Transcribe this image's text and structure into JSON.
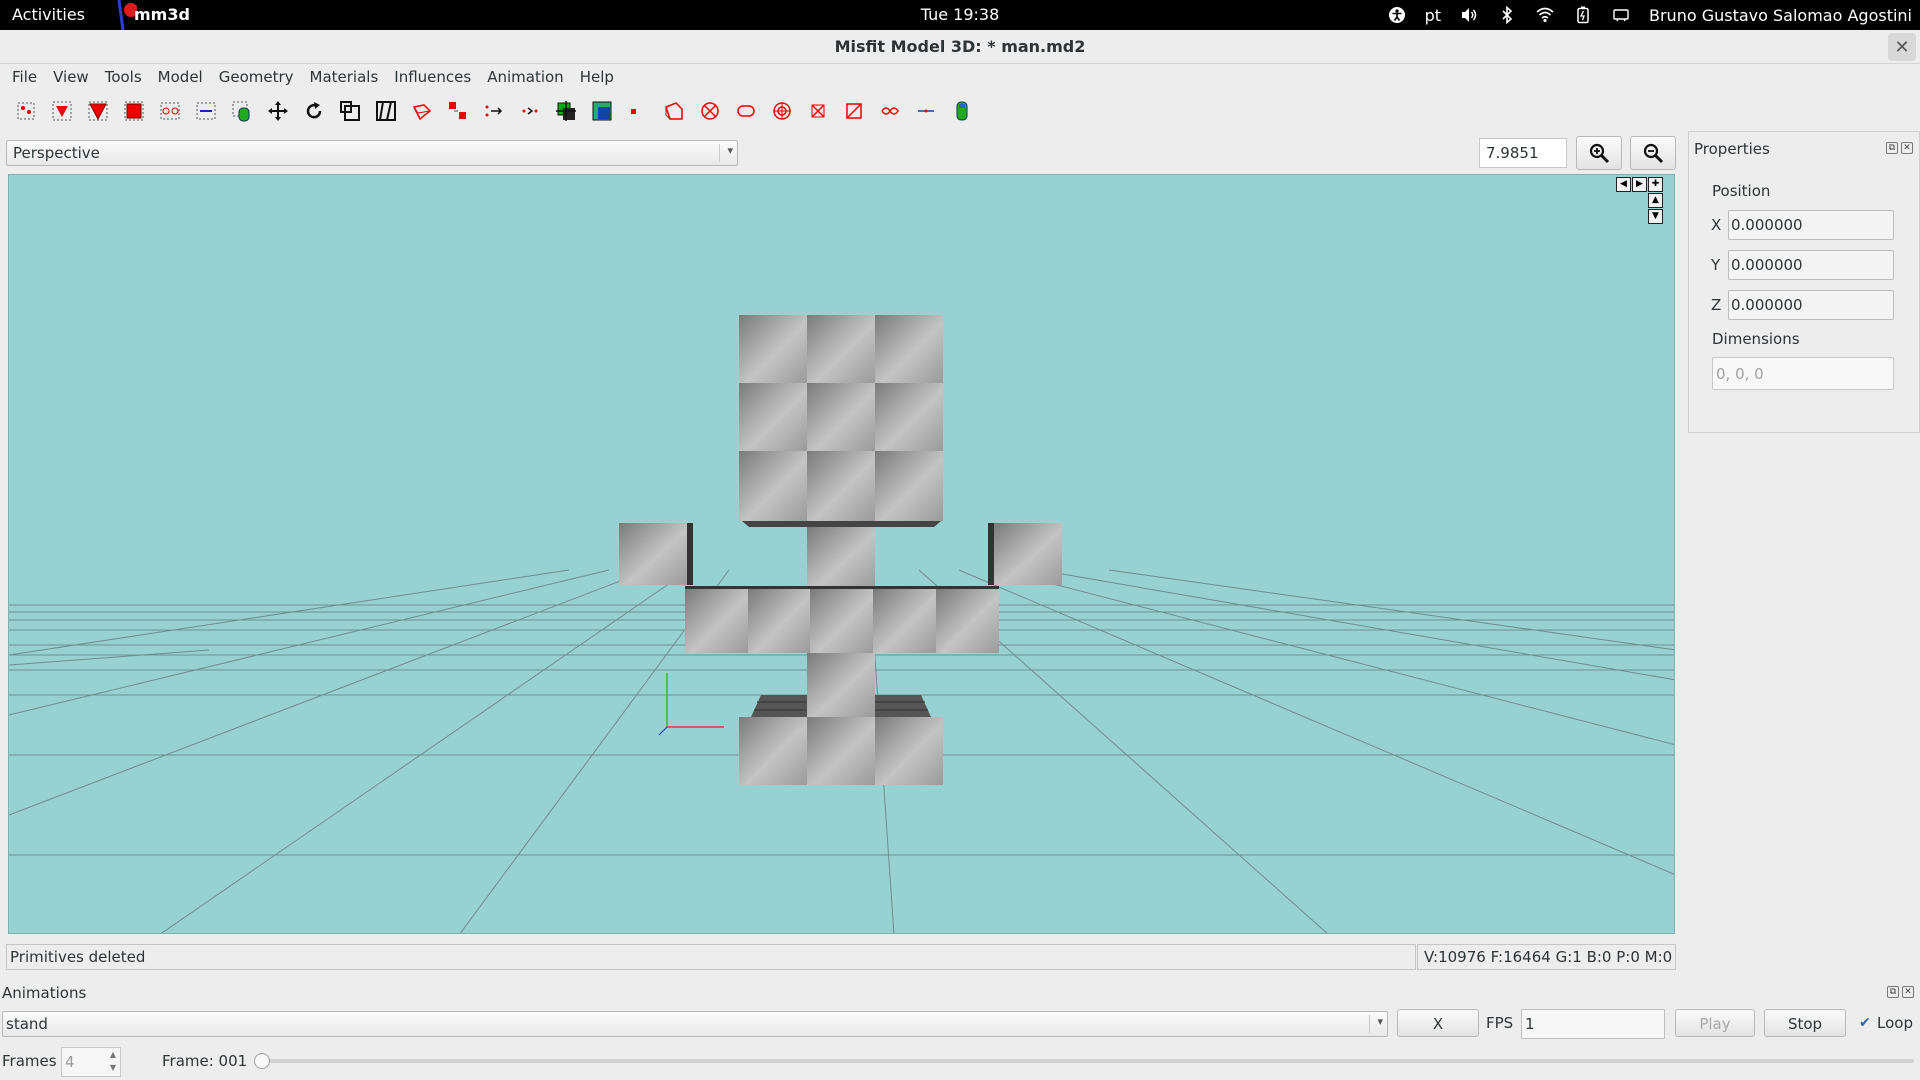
{
  "topbar": {
    "activities": "Activities",
    "app_name": "mm3d",
    "clock": "Tue 19:38",
    "keyboard_layout": "pt",
    "user_name": "Bruno Gustavo Salomao Agostini"
  },
  "window": {
    "title": "Misfit Model 3D: * man.md2",
    "close_glyph": "✕"
  },
  "menu": {
    "items": [
      "File",
      "View",
      "Tools",
      "Model",
      "Geometry",
      "Materials",
      "Influences",
      "Animation",
      "Help"
    ]
  },
  "toolbar": {
    "icons": [
      "select-vertices-icon",
      "select-faces-icon",
      "select-connected-icon",
      "select-groups-icon",
      "select-bone-joints-icon",
      "select-points-icon",
      "select-projections-icon",
      "move-icon",
      "rotate-icon",
      "scale-icon",
      "shear-icon",
      "extrude-icon",
      "attract-near-icon",
      "attract-far-icon",
      "add-vertex-icon",
      "add-joint-icon",
      "add-point-icon",
      "add-projection-icon",
      "add-background-image-icon",
      "create-cube-icon",
      "create-ellipsoid-icon",
      "create-cylinder-icon",
      "create-torus-icon",
      "create-polygon-icon",
      "create-rectangle-icon",
      "create-dragvertex-icon",
      "create-bone-icon",
      "create-camera-icon"
    ]
  },
  "view": {
    "selected": "Perspective",
    "zoom_level": "7.9851",
    "zoom_in_icon": "zoom-in-icon",
    "zoom_out_icon": "zoom-out-icon",
    "background_color": "#97d1d1"
  },
  "properties": {
    "title": "Properties",
    "position_label": "Position",
    "x_label": "X",
    "x_value": "0.000000",
    "y_label": "Y",
    "y_value": "0.000000",
    "z_label": "Z",
    "z_value": "0.000000",
    "dimensions_label": "Dimensions",
    "dimensions_value": "0, 0, 0"
  },
  "status": {
    "message": "Primitives deleted",
    "counts": "V:10976 F:16464 G:1 B:0 P:0 M:0"
  },
  "animations": {
    "title": "Animations",
    "selected": "stand",
    "x_button": "X",
    "fps_label": "FPS",
    "fps_value": "1",
    "play_button": "Play",
    "stop_button": "Stop",
    "loop_label": "Loop",
    "loop_checked": true,
    "frames_label": "Frames",
    "frames_value": "4",
    "frame_label": "Frame: 001",
    "frame_position": 0.0
  }
}
